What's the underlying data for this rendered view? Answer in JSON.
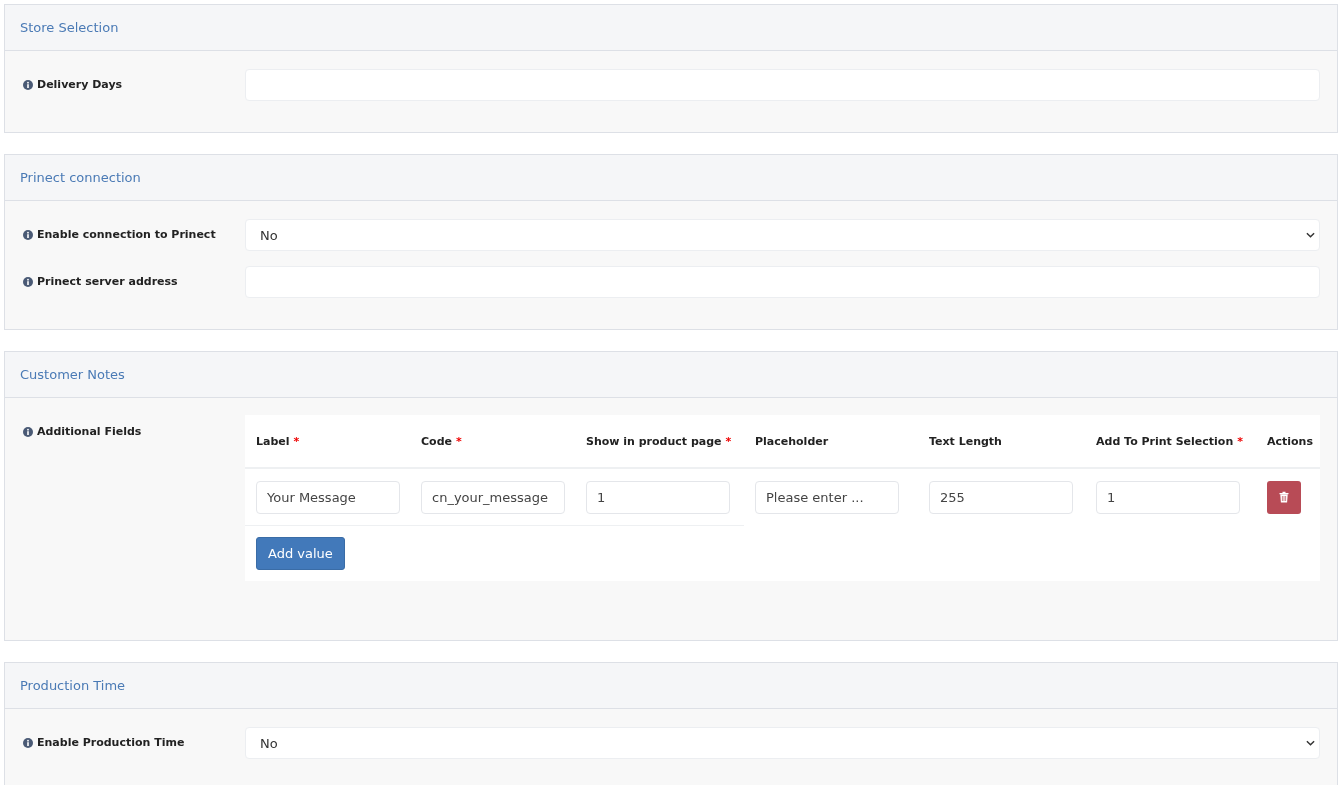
{
  "sections": [
    {
      "title": "Store Selection",
      "fields": [
        {
          "kind": "text",
          "label": "Delivery Days"
        }
      ]
    },
    {
      "title": "Prinect connection",
      "fields": [
        {
          "kind": "select",
          "label": "Enable connection to Prinect",
          "value": "No"
        },
        {
          "kind": "text",
          "label": "Prinect server address"
        }
      ]
    },
    {
      "title": "Customer Notes",
      "fields": [
        {
          "kind": "table",
          "label": "Additional Fields",
          "columns": [
            {
              "label": "Label",
              "mark": "*"
            },
            {
              "label": "Code",
              "mark": "*"
            },
            {
              "label": "Show in product page",
              "mark": "*"
            },
            {
              "label": "Placeholder"
            },
            {
              "label": "Text Length"
            },
            {
              "label": "Add To Print Selection",
              "mark": "*"
            },
            {
              "label": "Actions"
            }
          ],
          "rows": [
            [
              "Your Message",
              "cn_your_message",
              "1",
              "Please enter ...",
              "255",
              "1"
            ]
          ],
          "add_button": "Add value"
        }
      ]
    },
    {
      "title": "Production Time",
      "fields": [
        {
          "kind": "select",
          "label": "Enable Production Time",
          "value": "No"
        }
      ]
    }
  ]
}
